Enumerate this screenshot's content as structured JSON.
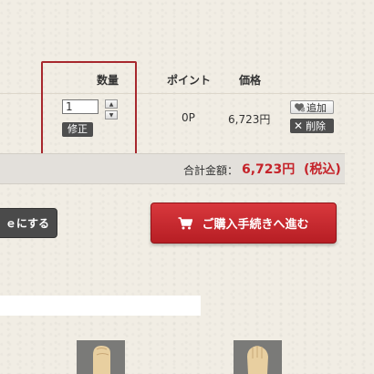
{
  "table": {
    "headers": {
      "quantity": "数量",
      "points": "ポイント",
      "price": "価格"
    }
  },
  "item": {
    "quantity_value": "1",
    "fix_label": "修正",
    "points": "0P",
    "price": "6,723円",
    "add_label": "追加",
    "delete_label": "削除"
  },
  "summary": {
    "total_label": "合計金額：",
    "total_amount": "6,723円",
    "tax_label": "(税込)"
  },
  "actions": {
    "wishlist_label": "ｅにする",
    "checkout_label": "ご購入手続きへ進む"
  },
  "colors": {
    "accent_red": "#c5232a",
    "highlight_border": "#a7272d",
    "dark_button": "#4e4e4e",
    "background": "#f1ede4"
  },
  "icons": {
    "stepper_up": "triangle-up-icon",
    "stepper_down": "triangle-down-icon",
    "add": "heart-plus-icon",
    "delete": "x-icon",
    "checkout": "cart-icon"
  },
  "glyphs": {
    "up": "▲",
    "down": "▼",
    "x": "✕"
  }
}
